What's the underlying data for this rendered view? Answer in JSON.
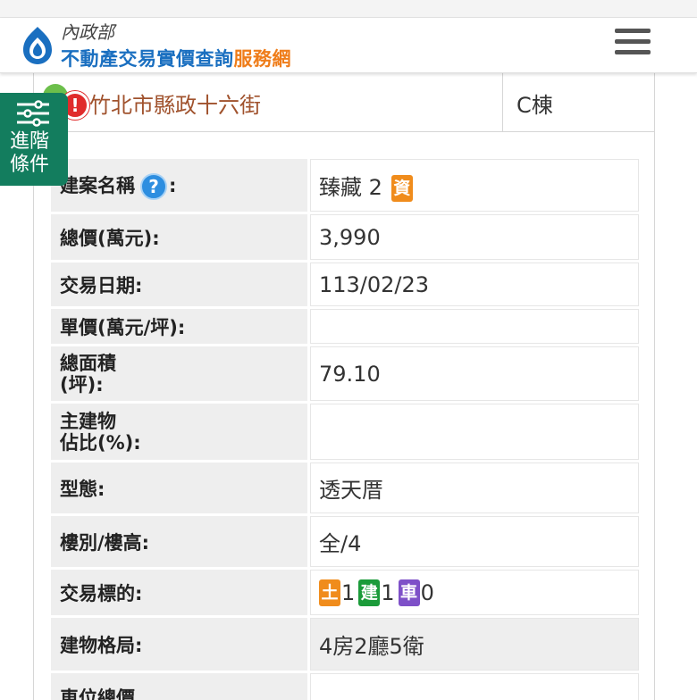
{
  "header": {
    "ministry": "內政部",
    "site_name_main": "不動產交易實價查詢",
    "site_name_accent": "服務網",
    "menu_icon": "hamburger-menu-icon",
    "brand_color": "#1a6fc0",
    "accent_color": "#ef7d1a"
  },
  "address": {
    "text": "竹北市縣政十六街",
    "building": "C棟",
    "text_color": "#a0522d"
  },
  "side_filter": {
    "line1": "進階",
    "line2": "條件",
    "icon": "sliders-icon",
    "color": "#137d5e"
  },
  "details": {
    "project_name_label": "建案名稱",
    "project_name_suffix": ":",
    "project_name": "臻藏 2",
    "project_badge": "資",
    "total_price_label": "總價(萬元):",
    "total_price": "3,990",
    "trade_date_label": "交易日期:",
    "trade_date": "113/02/23",
    "unit_price_label": "單價(萬元/坪):",
    "unit_price": "",
    "area_label_line1": "總面積",
    "area_label_line2": "(坪):",
    "area": "79.10",
    "main_ratio_label_line1": "主建物",
    "main_ratio_label_line2": "佔比(%):",
    "main_ratio": "",
    "type_label": "型態:",
    "type": "透天厝",
    "floor_label": "樓別/樓高:",
    "floor": "全/4",
    "target_label": "交易標的:",
    "target_land_tag": "土",
    "target_land_count": "1",
    "target_building_tag": "建",
    "target_building_count": "1",
    "target_car_tag": "車",
    "target_car_count": "0",
    "layout_label": "建物格局:",
    "layout": "4房2廳5衛",
    "parking_label": "車位總價",
    "parking": ""
  }
}
